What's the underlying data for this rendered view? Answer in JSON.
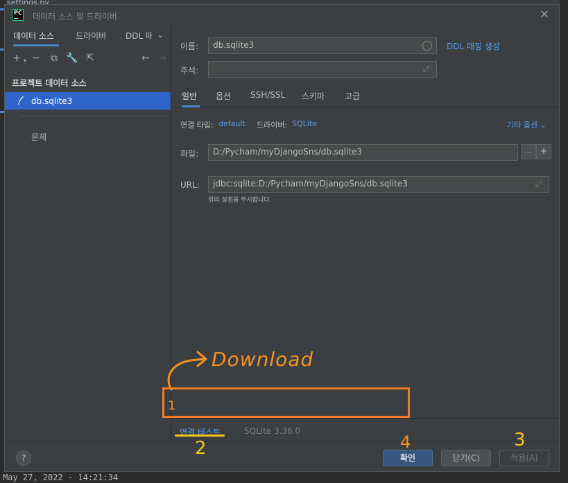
{
  "background": {
    "file_tab": "settings.py",
    "bottom_text": "May 27, 2022 - 14:21:34"
  },
  "dialog": {
    "title": "데이터 소스 및 드라이버",
    "close_icon": "close-icon"
  },
  "left_panel": {
    "tabs": [
      "데이터 소스",
      "드라이버",
      "DDL 매"
    ],
    "toolbar_icons": [
      "add-icon",
      "remove-icon",
      "copy-icon",
      "wrench-icon",
      "open-icon",
      "back-arrow-icon",
      "forward-arrow-icon"
    ],
    "section_title": "프로젝트 데이터 소스",
    "selected_item": "db.sqlite3",
    "problems_label": "문제"
  },
  "right_panel": {
    "name_label": "이름:",
    "name_value": "db.sqlite3",
    "ddl_link": "DDL 매핑 생성",
    "comment_label": "주석:",
    "comment_value": "",
    "tabs": [
      "일반",
      "옵션",
      "SSH/SSL",
      "스키마",
      "고급"
    ],
    "connection_type_label": "연결 타입:",
    "connection_type_value": "default",
    "driver_label": "드라이버:",
    "driver_value": "SQLite",
    "more_options": "기타 옵션",
    "file_label": "파일:",
    "file_value": "D:/Pycham/myDjangoSns/db.sqlite3",
    "url_label": "URL:",
    "url_value": "jdbc:sqlite:D:/Pycham/myDjangoSns/db.sqlite3",
    "url_hint": "위의 설정을 무시합니다."
  },
  "footer": {
    "test_connection": "연결 테스트",
    "sqlite_version": "SQLite 3.36.0",
    "help": "?",
    "ok": "확인",
    "close": "닫기(C)",
    "apply": "적용(A)"
  },
  "annotations": {
    "download": "Download",
    "n1": "1",
    "n2": "2",
    "n3": "3",
    "n4": "4",
    "color": "#f59023"
  }
}
